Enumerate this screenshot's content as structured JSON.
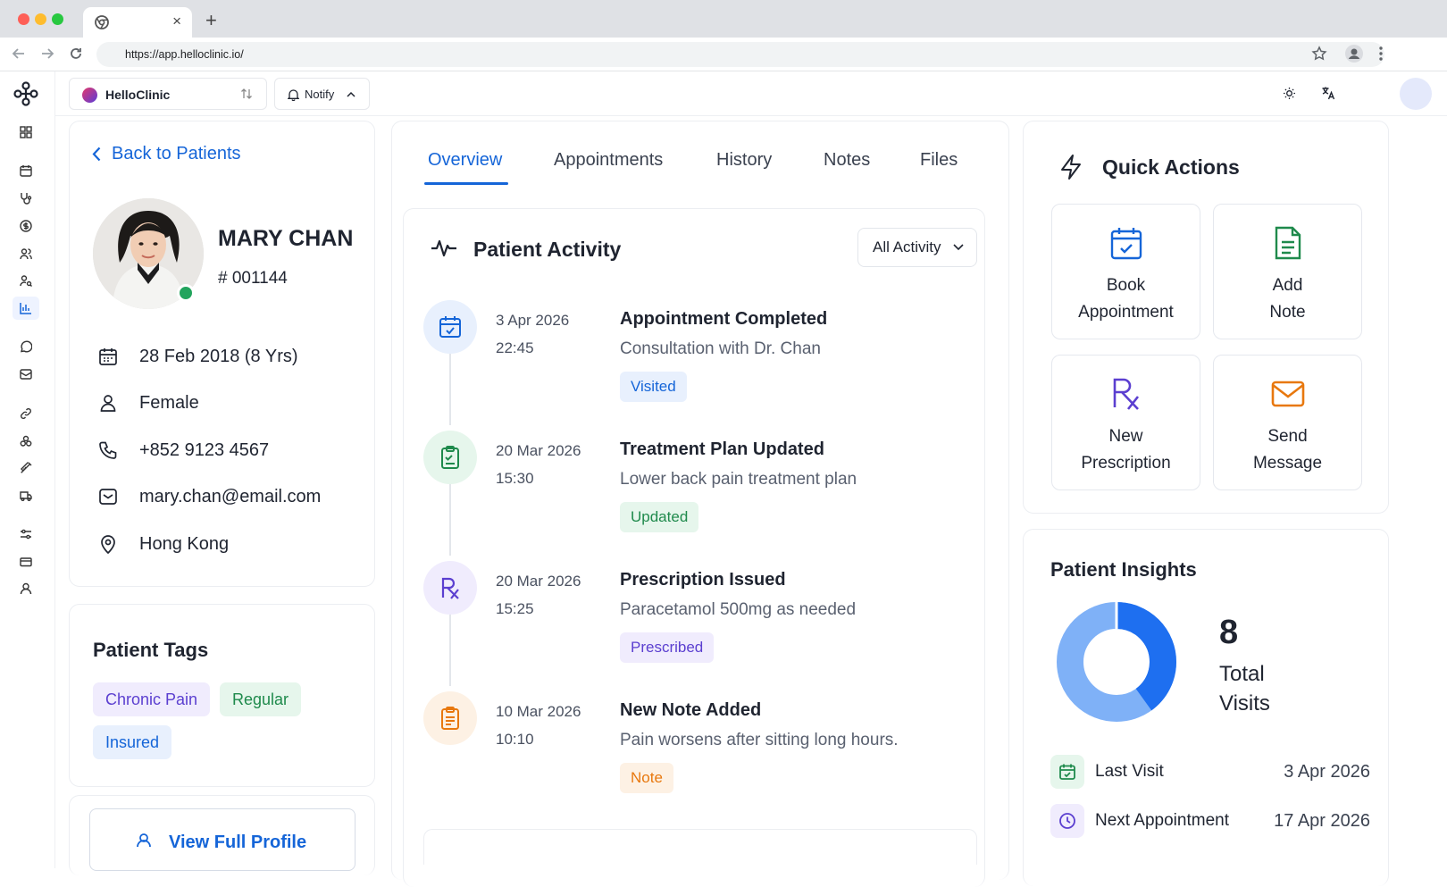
{
  "browser": {
    "url": "https://app.helloclinic.io/",
    "tab_close": "×",
    "new_tab": "+"
  },
  "topbar": {
    "clinic_name": "HelloClinic",
    "notify_label": "Notify"
  },
  "patient": {
    "back_label": "Back to Patients",
    "name": "MARY CHAN",
    "id": "# 001144",
    "dob": "28 Feb 2018 (8 Yrs)",
    "gender": "Female",
    "phone": "+852 9123 4567",
    "email": "mary.chan@email.com",
    "location": "Hong Kong",
    "online_color": "#22a45d"
  },
  "tags": {
    "title": "Patient Tags",
    "items": [
      {
        "label": "Chronic Pain",
        "color": "#5b3fd0",
        "bg": "#f0ecfd"
      },
      {
        "label": "Regular",
        "color": "#1f8a4c",
        "bg": "#e6f6ec"
      },
      {
        "label": "Insured",
        "color": "#1565d8",
        "bg": "#e8f0fd"
      }
    ],
    "view_profile": "View Full Profile"
  },
  "tabs": [
    "Overview",
    "Appointments",
    "History",
    "Notes",
    "Files"
  ],
  "active_tab": "Overview",
  "activity": {
    "title": "Patient Activity",
    "filter": "All Activity",
    "items": [
      {
        "date": "3 Apr 2026",
        "time": "22:45",
        "title": "Appointment Completed",
        "desc": "Consultation with Dr. Chan",
        "badge": "Visited",
        "icon": "calendar-check-icon",
        "color": "#1565d8",
        "bg": "#e8f0fd"
      },
      {
        "date": "20 Mar 2026",
        "time": "15:30",
        "title": "Treatment Plan Updated",
        "desc": "Lower back pain treatment plan",
        "badge": "Updated",
        "icon": "clipboard-icon",
        "color": "#1f8a4c",
        "bg": "#e6f6ec"
      },
      {
        "date": "20 Mar 2026",
        "time": "15:25",
        "title": "Prescription Issued",
        "desc": "Paracetamol 500mg as needed",
        "badge": "Prescribed",
        "icon": "rx-icon",
        "color": "#5b3fd0",
        "bg": "#f0ecfd"
      },
      {
        "date": "10 Mar 2026",
        "time": "10:10",
        "title": "New Note Added",
        "desc": "Pain worsens after sitting long hours.",
        "badge": "Note",
        "icon": "note-icon",
        "color": "#e8780e",
        "bg": "#fdf1e4"
      }
    ]
  },
  "quick_actions": {
    "title": "Quick Actions",
    "items": [
      {
        "line1": "Book",
        "line2": "Appointment",
        "icon": "calendar-check-icon",
        "color": "#1565d8"
      },
      {
        "line1": "Add",
        "line2": "Note",
        "icon": "document-icon",
        "color": "#1f8a4c"
      },
      {
        "line1": "New",
        "line2": "Prescription",
        "icon": "rx-icon",
        "color": "#5b3fd0"
      },
      {
        "line1": "Send",
        "line2": "Message",
        "icon": "mail-icon",
        "color": "#e8780e"
      }
    ]
  },
  "insights": {
    "title": "Patient Insights",
    "total_visits": "8",
    "total_visits_label1": "Total",
    "total_visits_label2": "Visits",
    "donut_share": 0.4,
    "donut_colors": [
      "#1e6ff0",
      "#7fb1f7"
    ],
    "last_visit_label": "Last Visit",
    "last_visit": "3 Apr 2026",
    "next_appt_label": "Next Appointment",
    "next_appt": "17 Apr 2026"
  }
}
